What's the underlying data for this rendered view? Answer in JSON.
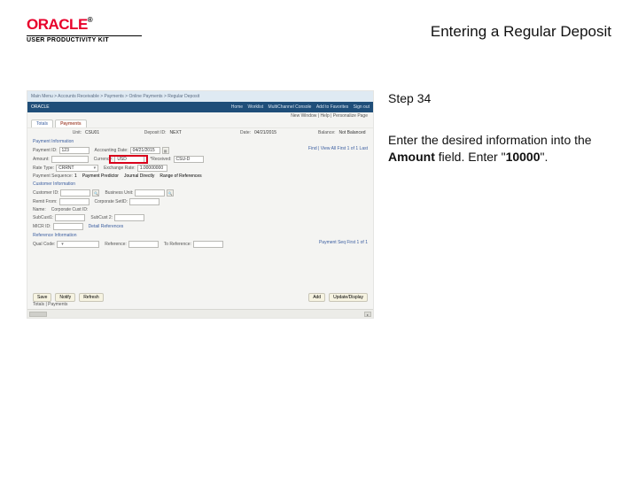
{
  "header": {
    "brand": "ORACLE",
    "reg": "®",
    "subbrand": "USER PRODUCTIVITY KIT",
    "page_title": "Entering a Regular Deposit"
  },
  "instructions": {
    "step_label": "Step 34",
    "line1": "Enter the desired information into the ",
    "bold1": "Amount",
    "line2": " field. Enter \"",
    "bold2": "10000",
    "line3": "\"."
  },
  "app": {
    "crumb": "Main Menu > Accounts Receivable > Payments > Online Payments > Regular Deposit",
    "brand": "ORACLE",
    "toplinks": [
      "Home",
      "Worklist",
      "MultiChannel Console",
      "Add to Favorites",
      "Sign out"
    ],
    "subnav": "New Window | Help | Personalize Page",
    "tabs": {
      "t1": "Totals",
      "t2": "Payments"
    },
    "row1": {
      "unit_l": "Unit:",
      "unit_v": "CSU01",
      "dep_l": "Deposit ID:",
      "dep_v": "NEXT",
      "date_l": "Date:",
      "date_v": "04/21/2015",
      "bal_l": "Balance:",
      "bal_v": "Not Balanced"
    },
    "sec_pay": "Payment Information",
    "pay": {
      "payid_l": "Payment ID:",
      "payid_v": "123",
      "amount_l": "Amount:",
      "recvd_l": "*Received:",
      "recvd_v": "CSU-D",
      "acct_l": "Accounting Date:",
      "acct_v": "04/21/2015",
      "curr_l": "Currency:",
      "curr_v": "USD",
      "rate_l": "Rate Type:",
      "rate_v": "CRRNT",
      "ex_l": "Exchange Rate:",
      "ex_v": "1.00000000",
      "opt1": "Payment Predictor",
      "opt2": "Journal Directly",
      "opt3": "Range of References",
      "seq_l": "Payment Sequence:",
      "seq_v": "1"
    },
    "findrow": "Find | View All    First 1 of 1 Last",
    "sec_cust": "Customer Information",
    "cust": {
      "custid_l": "Customer ID:",
      "bu_l": "Business Unit:",
      "name_l": "Name:",
      "ccode_l": "Corporate Cust ID:",
      "remit_l": "Remit From:",
      "corp_l": "Corporate SetID:",
      "sub_l": "SubCust1:",
      "sub2_l": "SubCust 2:",
      "mcr_l": "MICR ID:",
      "link": "Detail References"
    },
    "sec_ref": "Reference Information",
    "ref": {
      "qual_l": "Qual Code:",
      "ref_l": "Reference:",
      "to_l": "To Reference:",
      "pseq": "Payment Seq First 1 of 1"
    },
    "buttons": {
      "save": "Save",
      "notify": "Notify",
      "refresh": "Refresh",
      "add": "Add",
      "update": "Update/Display"
    },
    "footer_ref": "Totals | Payments"
  }
}
